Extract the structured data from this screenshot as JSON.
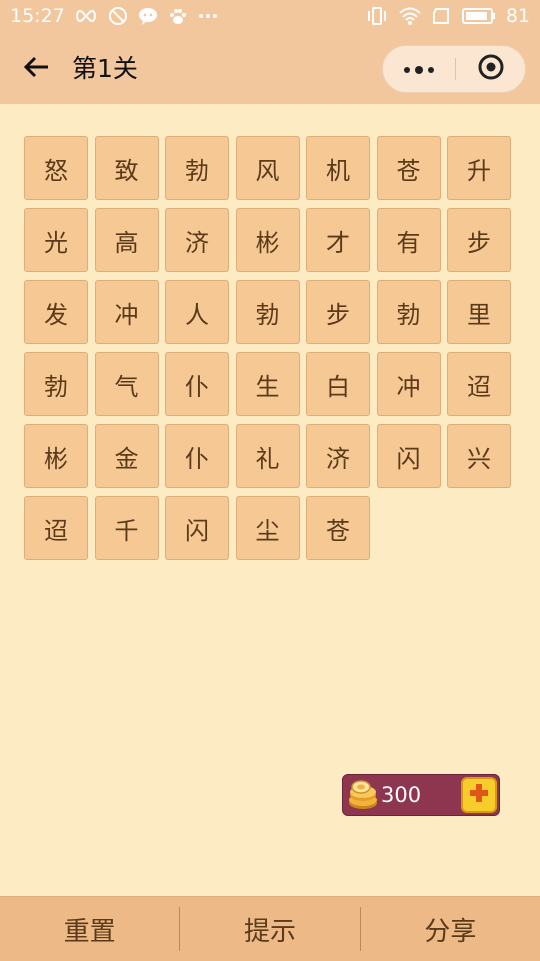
{
  "status_bar": {
    "time": "15:27",
    "battery": "81",
    "left_icons": [
      "infinity-icon",
      "no-disturb-icon",
      "chat-bubble-icon",
      "paw-icon",
      "more-dots-icon"
    ],
    "right_icons": [
      "vibrate-icon",
      "wifi-icon",
      "sim-icon",
      "battery-icon"
    ]
  },
  "nav": {
    "title": "第1关",
    "back_icon": "arrow-left-icon",
    "capsule_more_icon": "more-dots-icon",
    "capsule_close_icon": "target-icon"
  },
  "grid": {
    "tiles": [
      "怒",
      "致",
      "勃",
      "风",
      "机",
      "苍",
      "升",
      "光",
      "高",
      "济",
      "彬",
      "才",
      "有",
      "步",
      "发",
      "冲",
      "人",
      "勃",
      "步",
      "勃",
      "里",
      "勃",
      "气",
      "仆",
      "生",
      "白",
      "冲",
      "迢",
      "彬",
      "金",
      "仆",
      "礼",
      "济",
      "闪",
      "兴",
      "迢",
      "千",
      "闪",
      "尘",
      "苍"
    ]
  },
  "coins": {
    "count": "300",
    "icon": "coin-stack-icon",
    "add_icon": "plus-icon"
  },
  "bottom_bar": {
    "reset": "重置",
    "hint": "提示",
    "share": "分享"
  },
  "colors": {
    "background": "#FDEBC4",
    "header": "#F2C79E",
    "tile": "#F5C894",
    "tile_text": "#5B3A1A",
    "coin_box": "#8E3550",
    "bottom_bar": "#EDB987"
  }
}
